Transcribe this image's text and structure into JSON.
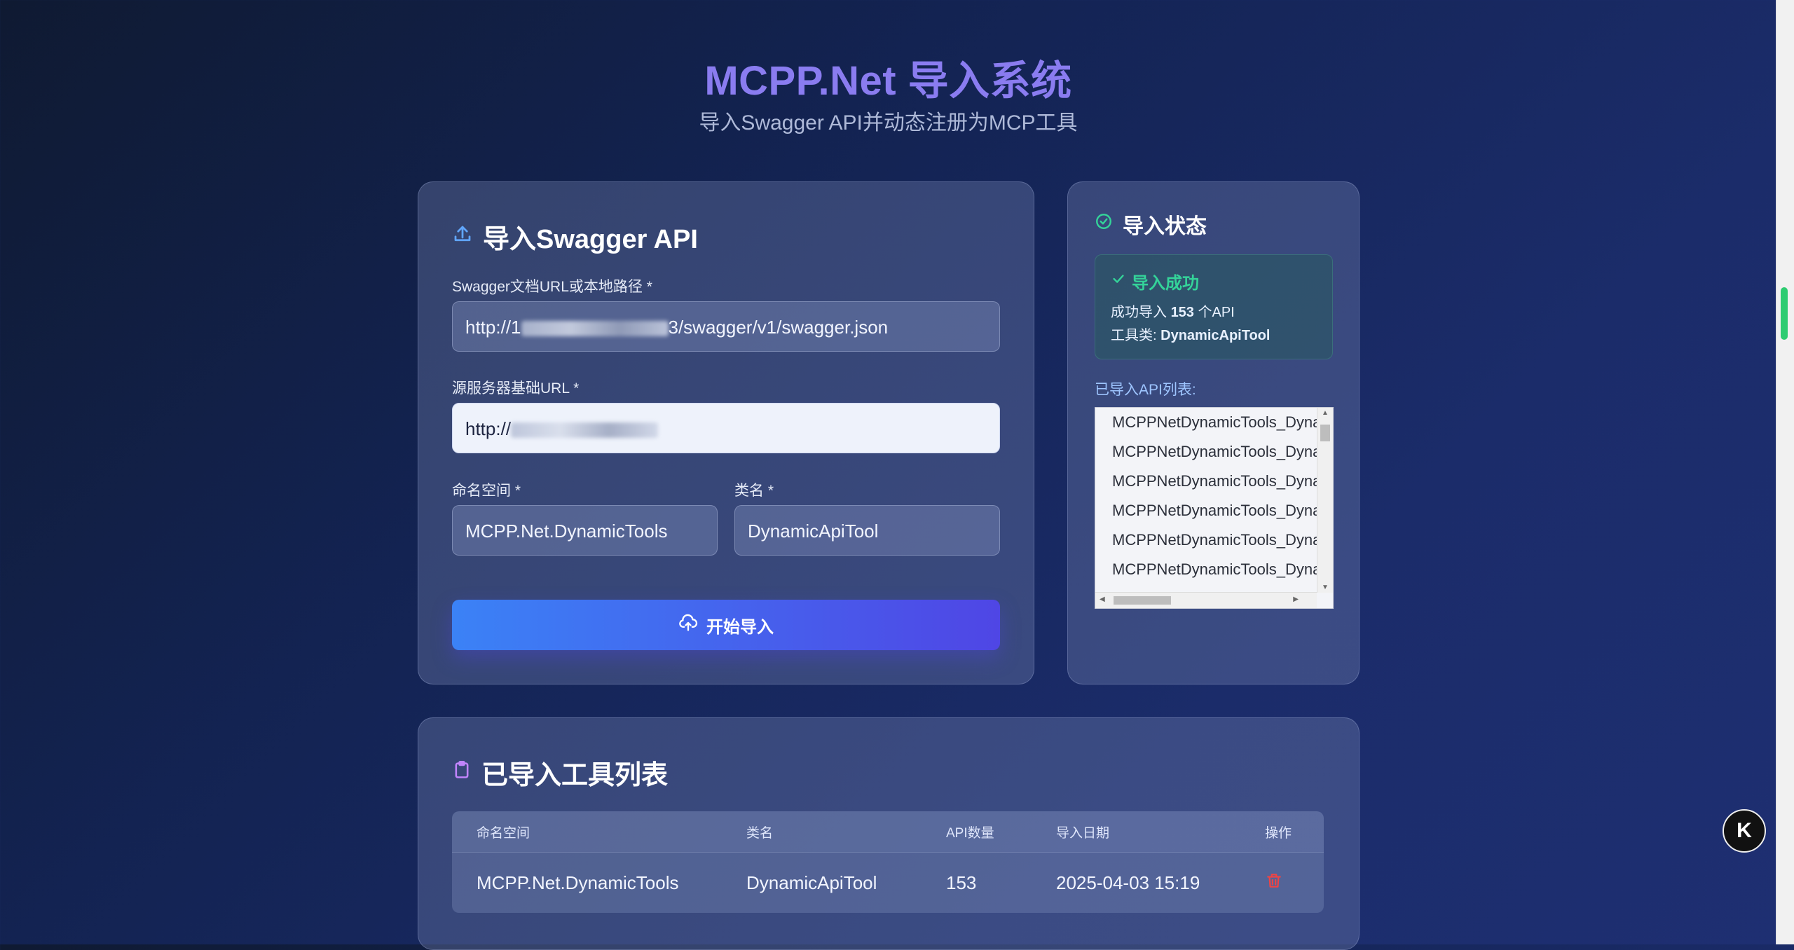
{
  "header": {
    "title": "MCPP.Net 导入系统",
    "subtitle": "导入Swagger API并动态注册为MCP工具"
  },
  "import_card": {
    "title": "导入Swagger API",
    "swagger_label": "Swagger文档URL或本地路径 *",
    "swagger_value_prefix": "http://1",
    "swagger_value_suffix": "3/swagger/v1/swagger.json",
    "base_url_label": "源服务器基础URL *",
    "base_url_value_prefix": "http://",
    "namespace_label": "命名空间 *",
    "namespace_value": "MCPP.Net.DynamicTools",
    "classname_label": "类名 *",
    "classname_value": "DynamicApiTool",
    "submit_label": "开始导入"
  },
  "status_card": {
    "title": "导入状态",
    "success_title": "导入成功",
    "success_count_prefix": "成功导入",
    "success_count": "153",
    "success_count_suffix": "个API",
    "tool_class_prefix": "工具类:",
    "tool_class": "DynamicApiTool",
    "list_label": "已导入API列表:",
    "api_items": [
      "MCPPNetDynamicTools_Dyna",
      "MCPPNetDynamicTools_Dyna",
      "MCPPNetDynamicTools_Dyna",
      "MCPPNetDynamicTools_Dyna",
      "MCPPNetDynamicTools_Dyna",
      "MCPPNetDynamicTools_Dyna"
    ]
  },
  "tools_card": {
    "title": "已导入工具列表",
    "columns": [
      "命名空间",
      "类名",
      "API数量",
      "导入日期",
      "操作"
    ],
    "rows": [
      {
        "namespace": "MCPP.Net.DynamicTools",
        "classname": "DynamicApiTool",
        "api_count": "153",
        "date": "2025-04-03 15:19"
      }
    ]
  },
  "colors": {
    "accent": "#8a7cf0",
    "primary_button_start": "#3b82f6",
    "primary_button_end": "#4f46e5",
    "success": "#34d399",
    "danger": "#ef4444"
  },
  "icons": {
    "import_title": "upload-icon",
    "status_title": "check-circle-icon",
    "success": "check-icon",
    "submit": "cloud-upload-icon",
    "tools_title": "clipboard-icon",
    "row_action": "trash-icon",
    "floating": "k-logo-icon"
  },
  "floating_badge": "K"
}
